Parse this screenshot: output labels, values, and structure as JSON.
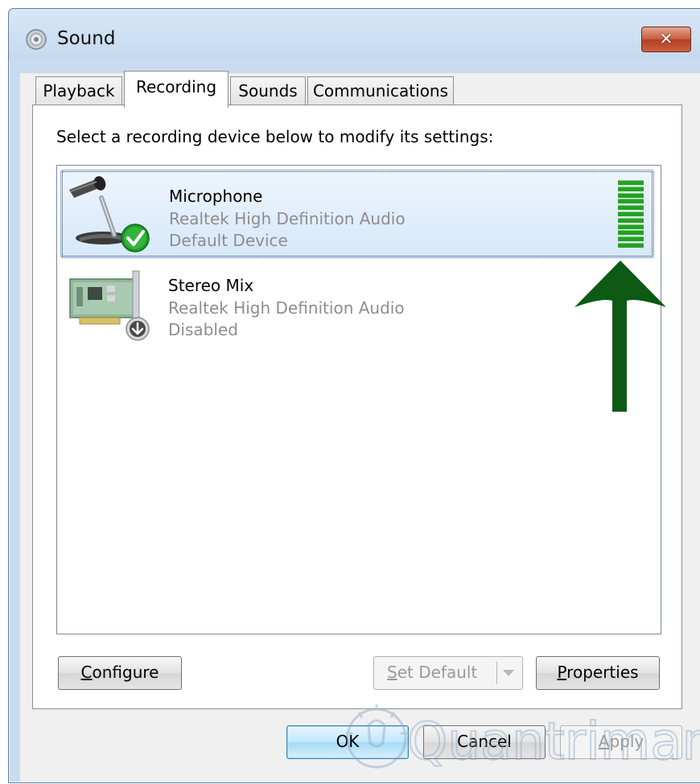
{
  "window": {
    "title": "Sound",
    "close_label": "✕"
  },
  "tabs": [
    {
      "label": "Playback",
      "active": false
    },
    {
      "label": "Recording",
      "active": true
    },
    {
      "label": "Sounds",
      "active": false
    },
    {
      "label": "Communications",
      "active": false
    }
  ],
  "recording": {
    "instruction": "Select a recording device below to modify its settings:",
    "devices": [
      {
        "name": "Microphone",
        "description": "Realtek High Definition Audio",
        "status": "Default Device",
        "icon": "microphone-icon",
        "badge": "default-check-icon",
        "selected": true,
        "level_bars_lit": 11
      },
      {
        "name": "Stereo Mix",
        "description": "Realtek High Definition Audio",
        "status": "Disabled",
        "icon": "sound-card-icon",
        "badge": "disabled-down-arrow-icon",
        "selected": false
      }
    ]
  },
  "panel_buttons": {
    "configure_first": "C",
    "configure_rest": "onfigure",
    "set_default_first": "S",
    "set_default_rest": "et Default",
    "properties_first": "P",
    "properties_rest": "roperties"
  },
  "dialog_buttons": {
    "ok": "OK",
    "cancel": "Cancel",
    "apply_first": "A",
    "apply_rest": "pply"
  },
  "annotation": {
    "arrow_color": "#0c5a14"
  },
  "colors": {
    "level_meter": "#25a123",
    "selection_border": "#84acdd"
  },
  "watermark": "Quantrimang"
}
